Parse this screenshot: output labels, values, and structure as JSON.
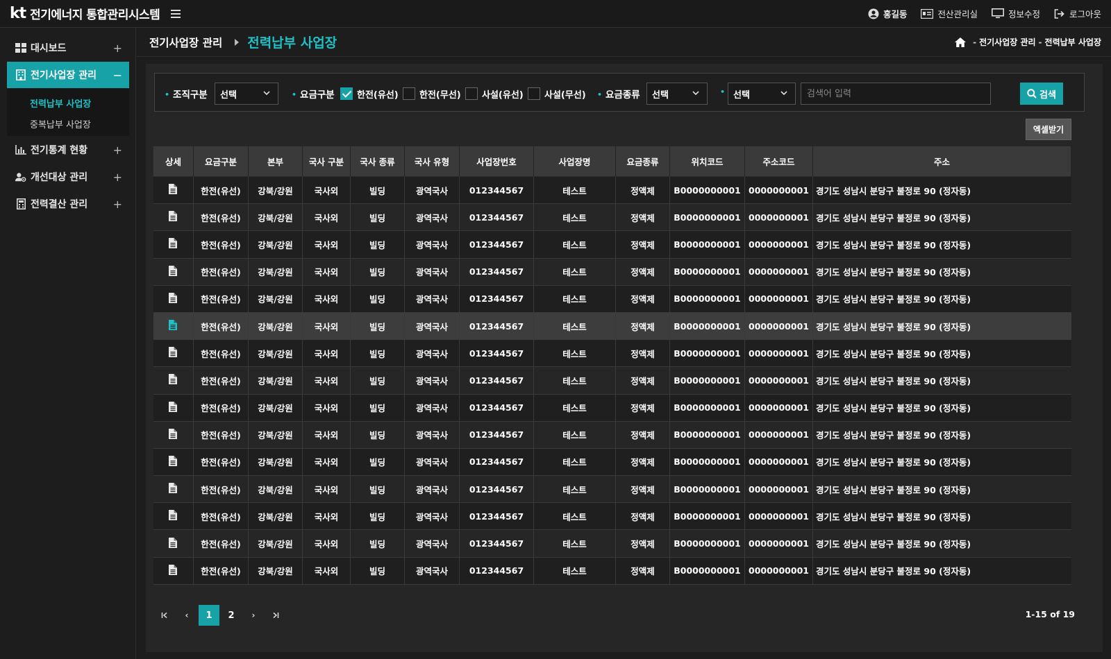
{
  "header": {
    "logo_text": "kt",
    "app_title": "전기에너지 통합관리시스템",
    "user_name": "홍길동",
    "links": [
      "전산관리실",
      "정보수정",
      "로그아웃"
    ]
  },
  "sidebar": {
    "items": [
      {
        "label": "대시보드",
        "toggle": "+"
      },
      {
        "label": "전기사업장 관리",
        "toggle": "−"
      },
      {
        "label": "전기통계 현황",
        "toggle": "+"
      },
      {
        "label": "개선대상 관리",
        "toggle": "+"
      },
      {
        "label": "전력결산 관리",
        "toggle": "+"
      }
    ],
    "submenu": [
      "전력납부 사업장",
      "중복납부 사업장"
    ]
  },
  "page": {
    "parent": "전기사업장 관리",
    "title": "전력납부 사업장",
    "crumb_parent": "전기사업장 관리",
    "crumb_current": "전력납부 사업장",
    "crumb_sep1": "-",
    "crumb_sep2": "-"
  },
  "filters": {
    "org_label": "조직구분",
    "org_value": "선택",
    "fee_label": "요금구분",
    "checkboxes": [
      {
        "label": "한전(유선)",
        "checked": true
      },
      {
        "label": "한전(무선)",
        "checked": false
      },
      {
        "label": "사설(유선)",
        "checked": false
      },
      {
        "label": "사설(무선)",
        "checked": false
      }
    ],
    "fee_type_label": "요금종류",
    "fee_type_value": "선택",
    "field_value": "선택",
    "search_placeholder": "검색어 입력",
    "search_button": "검색"
  },
  "excel_button": "엑셀받기",
  "table": {
    "headers": [
      "상세",
      "요금구분",
      "본부",
      "국사 구분",
      "국사 종류",
      "국사 유형",
      "사업장번호",
      "사업장명",
      "요금종류",
      "위치코드",
      "주소코드",
      "주소"
    ],
    "row": [
      "한전(유선)",
      "강북/강원",
      "국사외",
      "빌딩",
      "광역국사",
      "012344567",
      "테스트",
      "정액제",
      "B0000000001",
      "0000000001",
      "경기도 성남시 분당구 불정로 90 (정자동)"
    ],
    "row_count": 15,
    "highlight_row": 5
  },
  "pagination": {
    "pages": [
      "1",
      "2"
    ],
    "current": "1",
    "first": "⏮",
    "prev": "‹",
    "next": "›",
    "last": "⏭",
    "info": "1-15 of 19"
  },
  "colors": {
    "accent": "#17a2a8",
    "accent_text": "#1fc0c6",
    "background": "#1d1d1d",
    "panel": "#262626"
  }
}
